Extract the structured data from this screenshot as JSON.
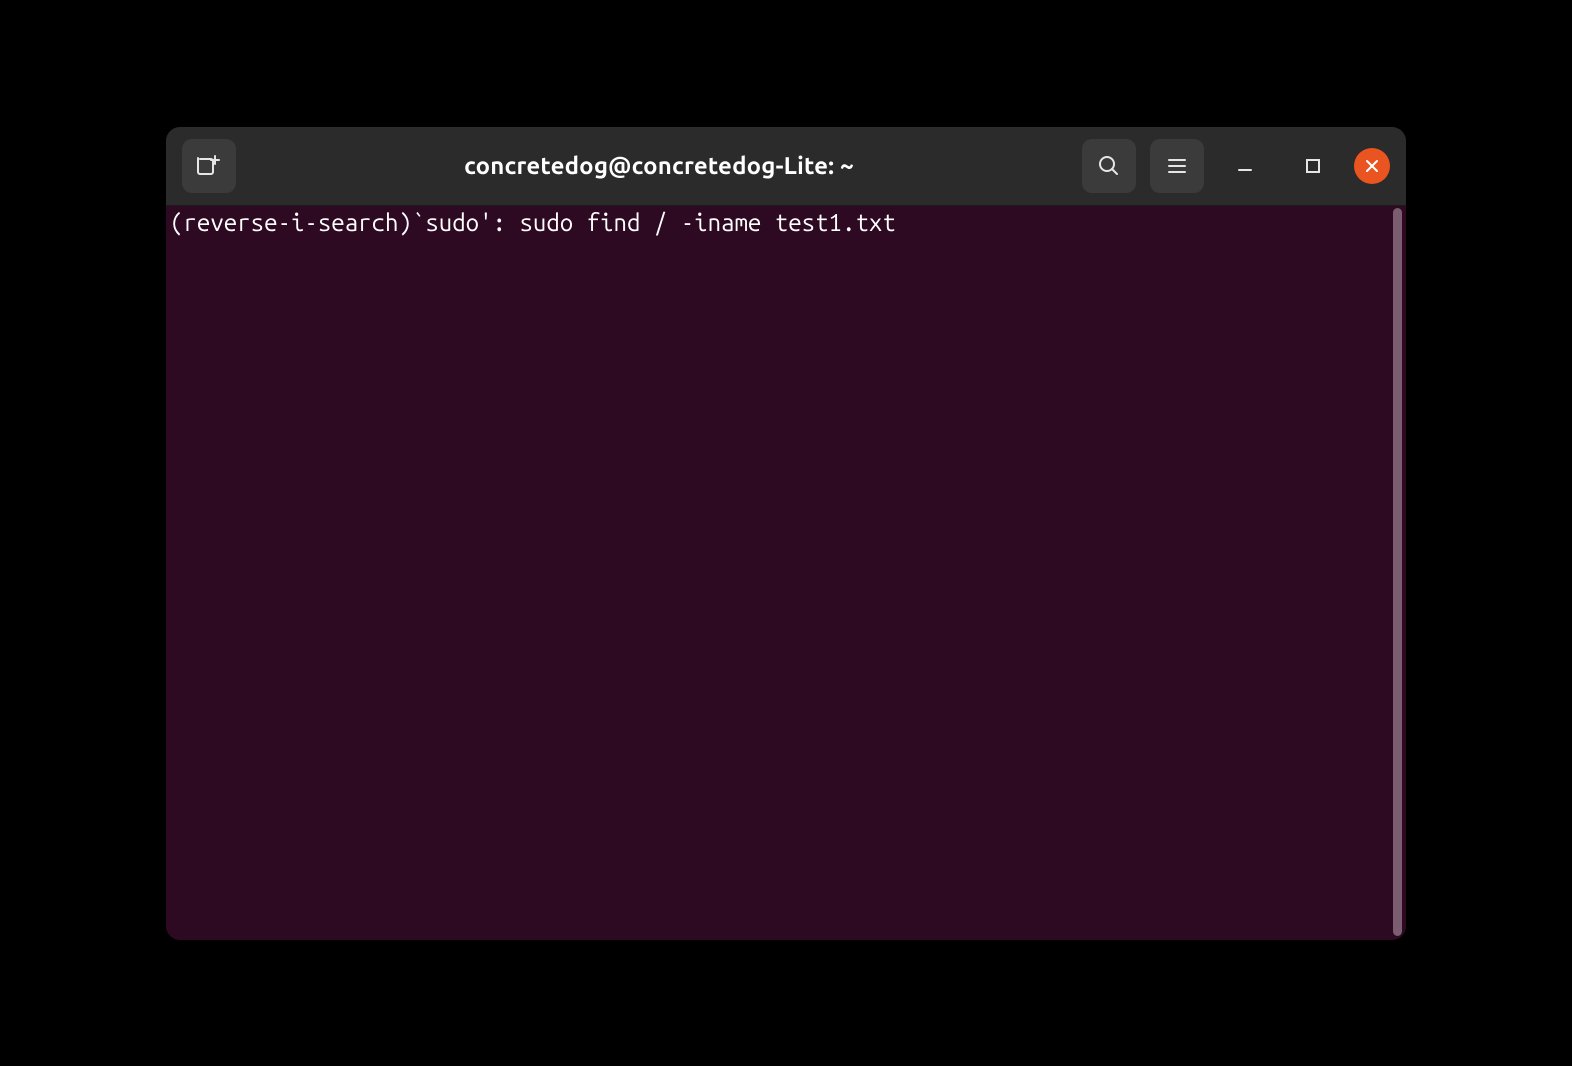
{
  "titlebar": {
    "title": "concretedog@concretedog-Lite: ~",
    "icons": {
      "new_tab": "new-tab-icon",
      "search": "search-icon",
      "menu": "hamburger-menu-icon",
      "minimize": "minimize-icon",
      "maximize": "maximize-icon",
      "close": "close-icon"
    }
  },
  "terminal": {
    "line1": "(reverse-i-search)`sudo': sudo find / -iname test1.txt",
    "search_query": "sudo",
    "matched_command": "sudo find / -iname test1.txt"
  },
  "colors": {
    "window_bg": "#2d0922",
    "titlebar_bg": "#2b2b2b",
    "button_bg": "#3b3b3b",
    "close_bg": "#e95420",
    "text": "#ffffff"
  }
}
